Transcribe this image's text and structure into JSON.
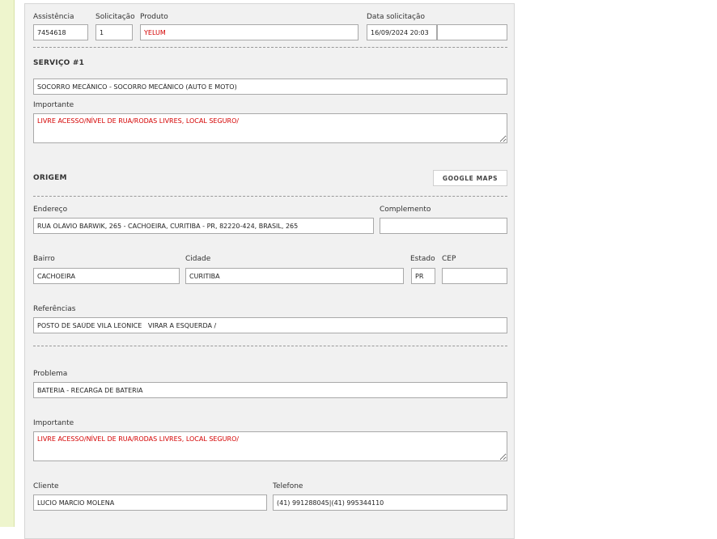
{
  "header": {
    "assistencia_label": "Assistência",
    "assistencia_value": "7454618",
    "solicitacao_label": "Solicitação",
    "solicitacao_value": "1",
    "produto_label": "Produto",
    "produto_value": "YELUM",
    "data_label": "Data solicitação",
    "data_value": "16/09/2024 20:03",
    "extra_value": ""
  },
  "servico": {
    "title": "SERVIÇO #1",
    "value": "SOCORRO MECÂNICO - SOCORRO MECÂNICO (AUTO E MOTO)",
    "importante_label": "Importante",
    "importante_value": "LIVRE ACESSO/NÍVEL DE RUA/RODAS LIVRES, LOCAL SEGURO/"
  },
  "origem": {
    "title": "ORIGEM",
    "maps_button": "GOOGLE MAPS",
    "endereco_label": "Endereço",
    "endereco_value": "RUA OLÁVIO BARWIK, 265 - CACHOEIRA, CURITIBA - PR, 82220-424, BRASIL, 265",
    "complemento_label": "Complemento",
    "complemento_value": "",
    "bairro_label": "Bairro",
    "bairro_value": "CACHOEIRA",
    "cidade_label": "Cidade",
    "cidade_value": "CURITIBA",
    "estado_label": "Estado",
    "estado_value": "PR",
    "cep_label": "CEP",
    "cep_value": "",
    "referencias_label": "Referências",
    "referencias_value": "POSTO DE SAÚDE VILA LEONICE   VIRAR A ESQUERDA /"
  },
  "detalhes": {
    "problema_label": "Problema",
    "problema_value": "BATERIA - RECARGA DE BATERIA",
    "importante_label": "Importante",
    "importante_value": "LIVRE ACESSO/NÍVEL DE RUA/RODAS LIVRES, LOCAL SEGURO/",
    "cliente_label": "Cliente",
    "cliente_value": "LUCIO MARCIO MOLENA",
    "telefone_label": "Telefone",
    "telefone_value": "(41) 991288045|(41) 995344110"
  }
}
